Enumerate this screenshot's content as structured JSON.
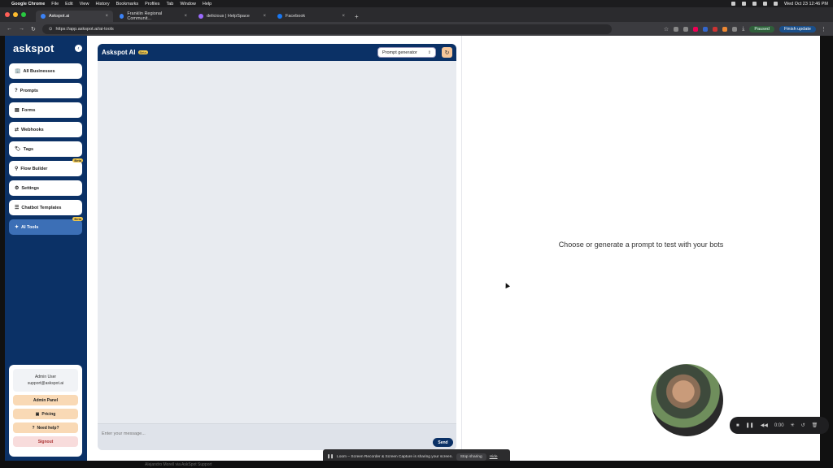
{
  "menubar": {
    "app": "Google Chrome",
    "menus": [
      "File",
      "Edit",
      "View",
      "History",
      "Bookmarks",
      "Profiles",
      "Tab",
      "Window",
      "Help"
    ],
    "clock": "Wed Oct 23  12:46 PM"
  },
  "tabs": [
    {
      "title": "Askspot.ai"
    },
    {
      "title": "Franklin Regional Communit..."
    },
    {
      "title": "delicious | HelpSpace"
    },
    {
      "title": "Facebook"
    }
  ],
  "address": {
    "url": "https://app.askspot.ai/ai-tools",
    "paused_label": "Paused",
    "finish_label": "Finish update"
  },
  "sidebar": {
    "logo": "askspot",
    "items": [
      {
        "label": "All Businesses",
        "icon": "🏢",
        "beta": ""
      },
      {
        "label": "Prompts",
        "icon": "?",
        "beta": ""
      },
      {
        "label": "Forms",
        "icon": "▤",
        "beta": ""
      },
      {
        "label": "Webhooks",
        "icon": "⇄",
        "beta": ""
      },
      {
        "label": "Tags",
        "icon": "🏷",
        "beta": ""
      },
      {
        "label": "Flow Builder",
        "icon": "⚲",
        "beta": "Beta"
      },
      {
        "label": "Settings",
        "icon": "⚙",
        "beta": ""
      },
      {
        "label": "Chatbot Templates",
        "icon": "☰",
        "beta": ""
      },
      {
        "label": "AI Tools",
        "icon": "✦",
        "beta": "Beta"
      }
    ],
    "user": {
      "name": "Admin User",
      "email": "support@askspot.ai",
      "admin_panel": "Admin Panel",
      "pricing": "Pricing",
      "help": "Need help?",
      "signout": "Signout"
    }
  },
  "chat": {
    "title": "Askspot AI",
    "beta": "Beta",
    "prompt_select": "Prompt generator",
    "input_placeholder": "Enter your message...",
    "send_label": "Send"
  },
  "main": {
    "placeholder": "Choose or generate a prompt to test with your bots"
  },
  "loom": {
    "timer": "0:00"
  },
  "sharebar": {
    "message": "Loom – Screen Recorder & Screen Capture is sharing your screen.",
    "stop": "Stop sharing",
    "hide": "Hide"
  },
  "dock": {
    "label": "Alejandro Morell via AskSpot Support"
  }
}
